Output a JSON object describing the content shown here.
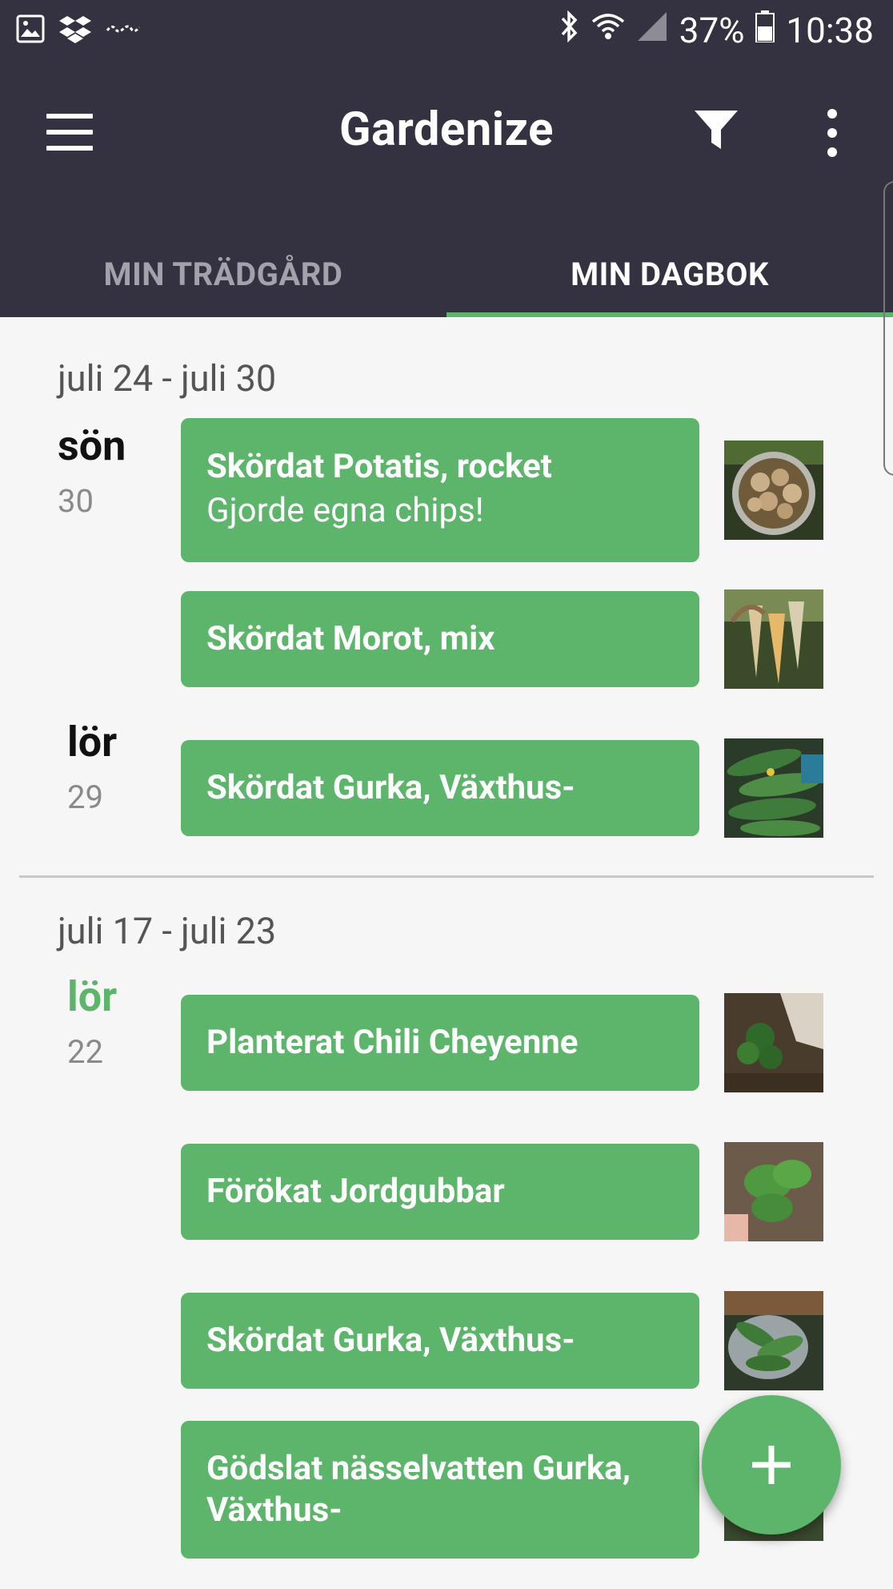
{
  "status_bar": {
    "battery": "37%",
    "time": "10:38",
    "icons": [
      "image-icon",
      "dropbox-icon",
      "voicemail-icon",
      "bluetooth-icon",
      "wifi-icon",
      "signal-icon",
      "battery-icon"
    ]
  },
  "app_bar": {
    "title": "Gardenize",
    "icons": [
      "menu-icon",
      "filter-icon",
      "more-vert-icon"
    ]
  },
  "tabs": [
    {
      "label": "MIN TRÄDGÅRD",
      "active": false
    },
    {
      "label": "MIN DAGBOK",
      "active": true
    }
  ],
  "weeks": [
    {
      "label": "juli 24 - juli 30",
      "days": [
        {
          "name": "sön",
          "num": "30",
          "highlight": false,
          "entries": [
            {
              "title": "Skördat Potatis, rocket",
              "subtitle": "Gjorde egna chips!",
              "thumb": "potatoes"
            },
            {
              "title": "Skördat Morot, mix",
              "subtitle": "",
              "thumb": "carrots"
            }
          ]
        },
        {
          "name": "lör",
          "num": "29",
          "highlight": false,
          "entries": [
            {
              "title": "Skördat Gurka, Växthus-",
              "subtitle": "",
              "thumb": "cucumbers"
            }
          ]
        }
      ]
    },
    {
      "label": "juli 17 - juli 23",
      "days": [
        {
          "name": "lör",
          "num": "22",
          "highlight": true,
          "entries": [
            {
              "title": "Planterat Chili Cheyenne",
              "subtitle": "",
              "thumb": "chili-plant"
            },
            {
              "title": "Förökat Jordgubbar",
              "subtitle": "",
              "thumb": "strawberry-leaves"
            },
            {
              "title": "Skördat Gurka, Växthus-",
              "subtitle": "",
              "thumb": "cucumbers-bowl"
            },
            {
              "title": "Gödslat nässelvatten Gurka, Växthus-",
              "subtitle": "",
              "thumb": "cucumber-plant"
            }
          ]
        }
      ]
    }
  ],
  "fab": {
    "icon": "plus-icon"
  },
  "colors": {
    "bar": "#343240",
    "accent": "#5cb56b",
    "background": "#f6f6f6"
  }
}
